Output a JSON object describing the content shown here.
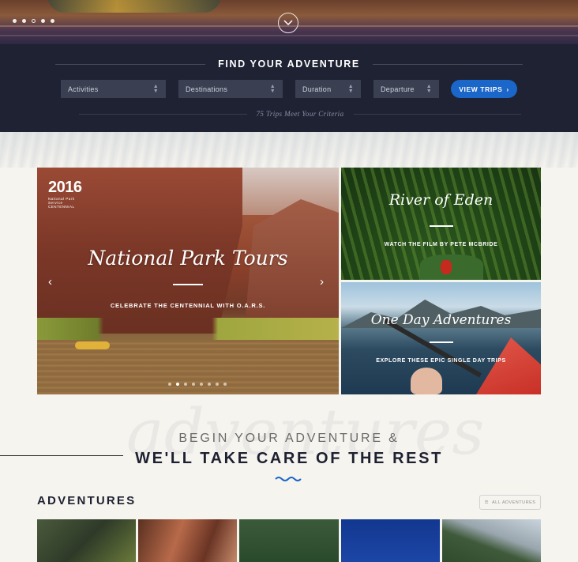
{
  "hero": {
    "slide_count": 4,
    "active_slide_index": 2
  },
  "search": {
    "title": "FIND YOUR ADVENTURE",
    "filters": [
      {
        "label": "Activities"
      },
      {
        "label": "Destinations"
      },
      {
        "label": "Duration"
      },
      {
        "label": "Departure"
      }
    ],
    "button_label": "VIEW TRIPS",
    "criteria_text": "75 Trips Meet Your Criteria"
  },
  "features": {
    "main": {
      "logo_year": "2016",
      "logo_text": "National Park Service CENTENNIAL",
      "title": "National Park Tours",
      "subtitle": "CELEBRATE THE CENTENNIAL WITH O.A.R.S.",
      "prev_glyph": "‹",
      "next_glyph": "›"
    },
    "river": {
      "title": "River of Eden",
      "subtitle": "WATCH THE FILM BY PETE MCBRIDE"
    },
    "oneday": {
      "title": "One Day Adventures",
      "subtitle": "EXPLORE THESE EPIC SINGLE DAY TRIPS"
    }
  },
  "tagline": {
    "line1": "BEGIN YOUR ADVENTURE &",
    "line2": "WE'LL TAKE CARE OF THE REST",
    "watermark": "adventures"
  },
  "adventures": {
    "heading": "ADVENTURES",
    "all_button_label": "ALL ADVENTURES"
  },
  "colors": {
    "accent_blue": "#1b66c9",
    "dark_navy": "#1e2233"
  }
}
